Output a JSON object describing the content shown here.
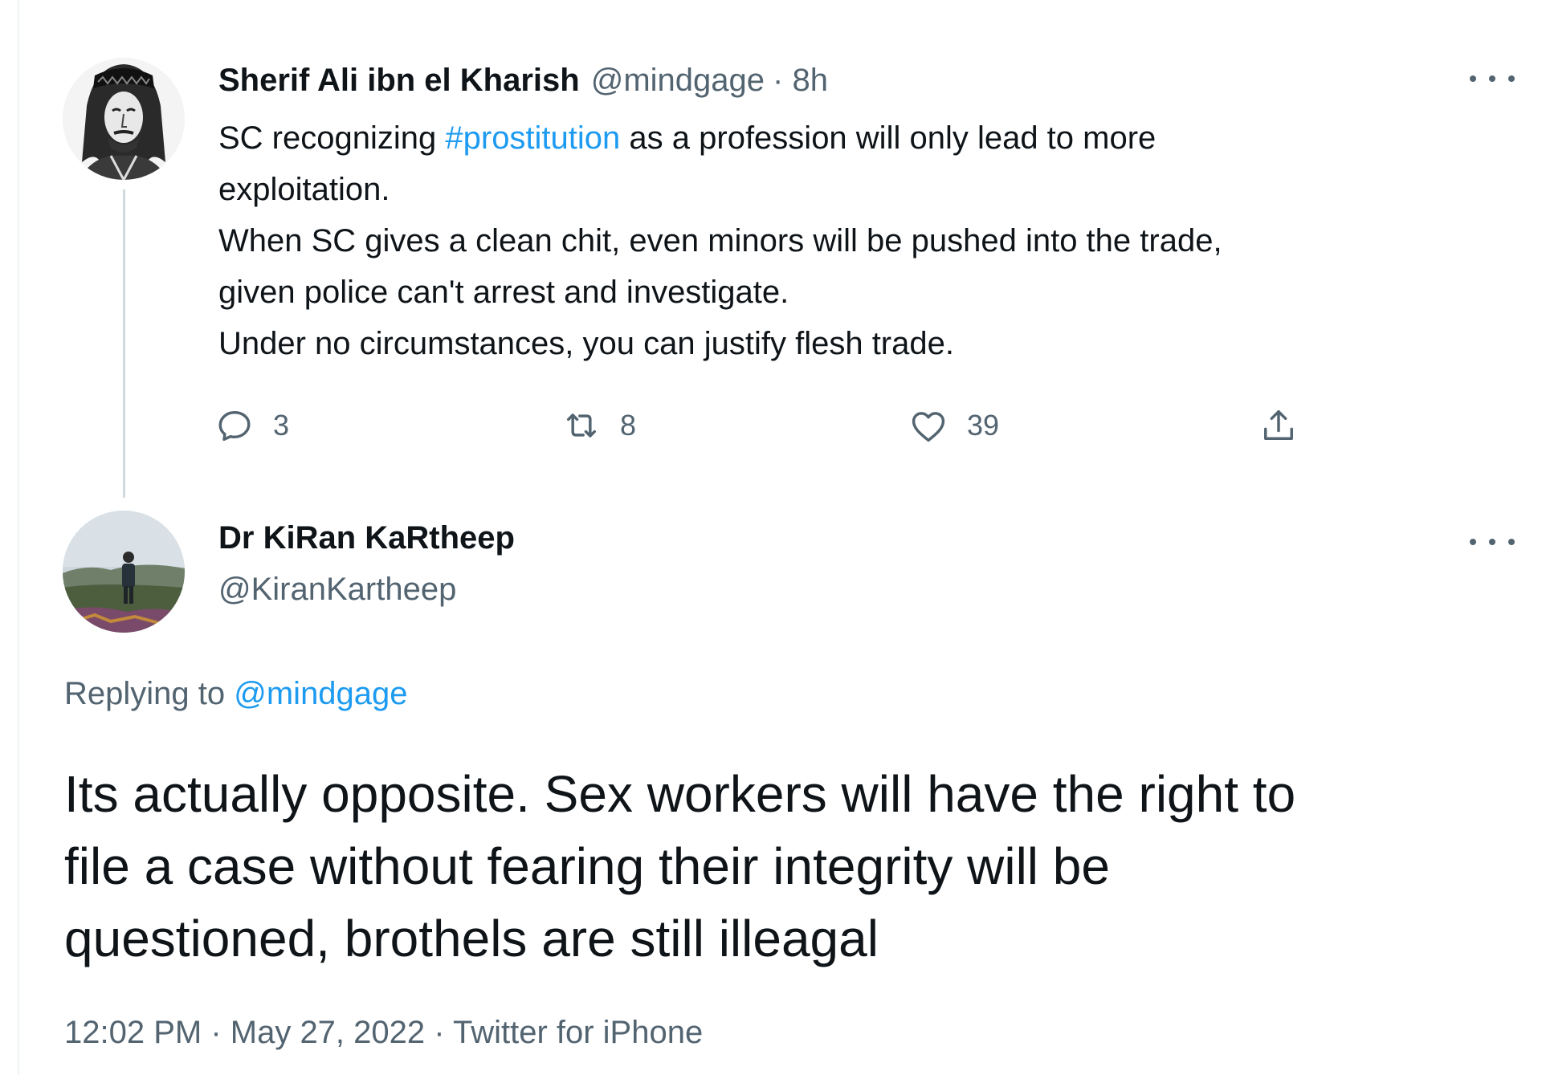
{
  "parent_tweet": {
    "display_name": "Sherif Ali ibn el Kharish",
    "handle": "@mindgage",
    "time": "· 8h",
    "text_lines": [
      {
        "before": "SC recognizing ",
        "hashtag": "#prostitution",
        "after": " as a profession will only lead to more"
      },
      {
        "text": "exploitation."
      },
      {
        "text": "When SC gives a clean chit, even minors will be pushed into the trade,"
      },
      {
        "text": "given police can't arrest and investigate."
      },
      {
        "text": "Under no circumstances, you can justify flesh trade."
      }
    ],
    "actions": {
      "reply_count": "3",
      "retweet_count": "8",
      "like_count": "39"
    }
  },
  "reply_tweet": {
    "display_name": "Dr KiRan KaRtheep",
    "handle": "@KiranKartheep",
    "replying_to_label": "Replying to",
    "replying_to_handle": "@mindgage",
    "text_lines": [
      "Its actually opposite. Sex workers will have the right to",
      "file a case without fearing their integrity will be",
      "questioned, brothels are still illeagal"
    ],
    "timestamp": "12:02 PM · May 27, 2022 · Twitter for iPhone"
  },
  "icons": {
    "reply": "reply-icon",
    "retweet": "retweet-icon",
    "like": "like-icon",
    "share": "share-icon",
    "more": "more-icon"
  },
  "colors": {
    "link": "#1d9bf0",
    "secondary_text": "#536471",
    "primary_text": "#0f1419"
  }
}
